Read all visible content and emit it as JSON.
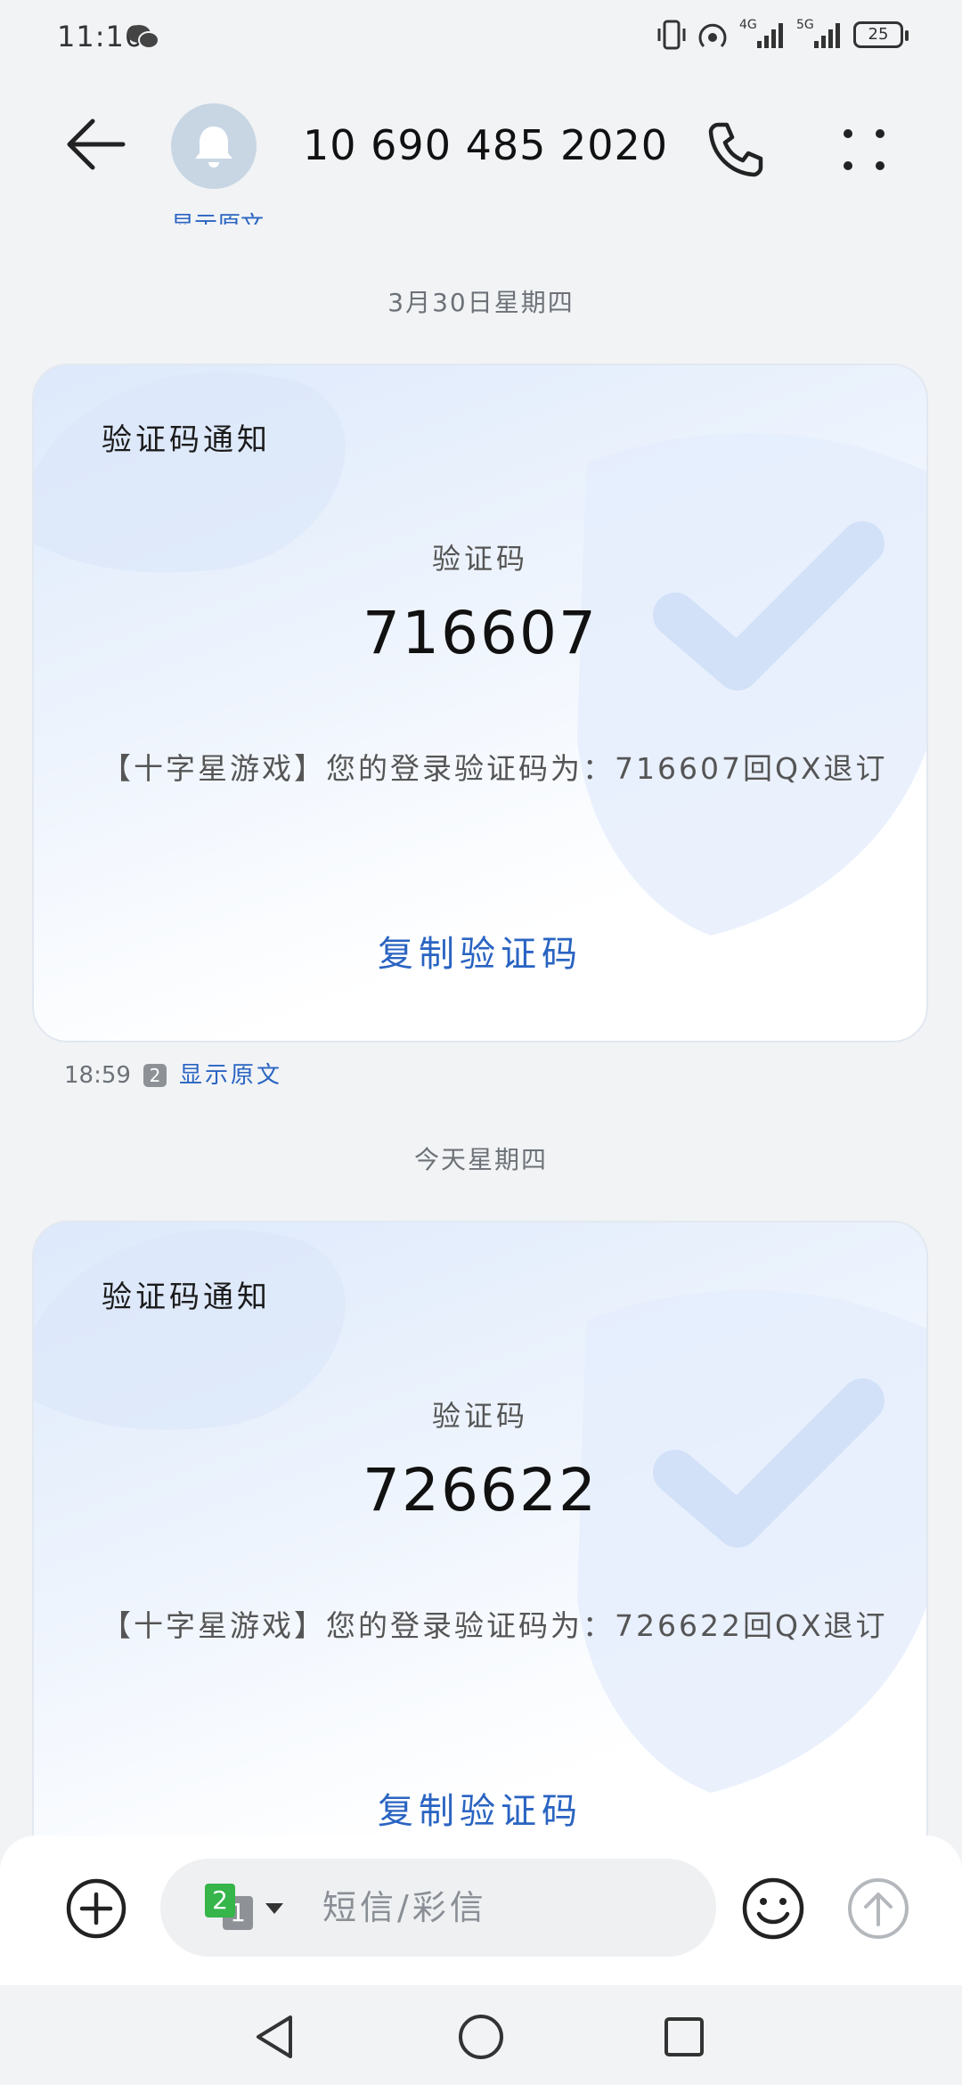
{
  "status_bar": {
    "time": "11:16",
    "battery": "25",
    "network_4g": "4G",
    "network_5g": "5G"
  },
  "header": {
    "title": "10 690 485 2020"
  },
  "thread": {
    "previous_meta_link": "显示原文",
    "messages": [
      {
        "date_separator": "3月30日星期四",
        "card_title": "验证码通知",
        "code_label": "验证码",
        "code": "716607",
        "body": "【十字星游戏】您的登录验证码为：716607回QX退订",
        "copy_label": "复制验证码",
        "time": "18:59",
        "sim": "2",
        "show_original": "显示原文"
      },
      {
        "date_separator": "今天星期四",
        "card_title": "验证码通知",
        "code_label": "验证码",
        "code": "726622",
        "body": "【十字星游戏】您的登录验证码为：726622回QX退订",
        "copy_label": "复制验证码"
      }
    ]
  },
  "compose": {
    "placeholder": "短信/彩信",
    "sim_primary": "2",
    "sim_secondary": "1"
  },
  "colors": {
    "accent_blue": "#2a64c2",
    "background": "#f1f3f5",
    "sim_green": "#35b54a",
    "sim_gray": "#8e9297"
  },
  "icons": {
    "back": "arrow-left-icon",
    "avatar": "bell-icon",
    "call": "phone-icon",
    "more": "more-dots-icon",
    "add": "plus-circle-icon",
    "emoji": "smiley-icon",
    "send": "arrow-up-circle-icon",
    "nav_back": "triangle-back-icon",
    "nav_home": "circle-home-icon",
    "nav_recents": "square-recents-icon"
  }
}
